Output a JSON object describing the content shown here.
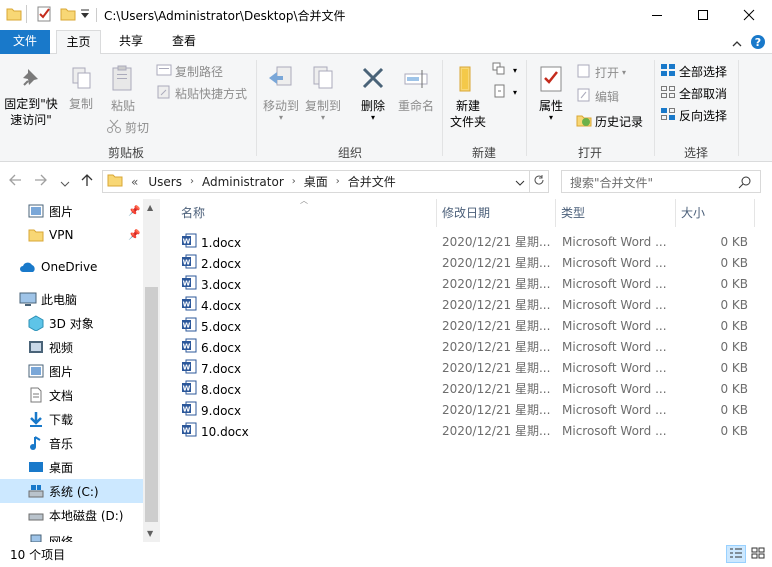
{
  "window": {
    "path": "C:\\Users\\Administrator\\Desktop\\合并文件"
  },
  "tabs": {
    "file": "文件",
    "home": "主页",
    "share": "共享",
    "view": "查看"
  },
  "ribbon": {
    "clipboard": {
      "pin_line1": "固定到\"快",
      "pin_line2": "速访问\"",
      "copy": "复制",
      "paste": "粘贴",
      "copy_path": "复制路径",
      "paste_shortcut": "粘贴快捷方式",
      "cut": "剪切",
      "label": "剪贴板"
    },
    "organize": {
      "move_to": "移动到",
      "copy_to": "复制到",
      "delete": "删除",
      "rename": "重命名",
      "label": "组织"
    },
    "new": {
      "new_folder_line1": "新建",
      "new_folder_line2": "文件夹",
      "label": "新建"
    },
    "open": {
      "properties": "属性",
      "open": "打开",
      "edit": "编辑",
      "history": "历史记录",
      "label": "打开"
    },
    "select": {
      "select_all": "全部选择",
      "select_none": "全部取消",
      "invert": "反向选择",
      "label": "选择"
    }
  },
  "address": {
    "overflow": "«",
    "segments": [
      "Users",
      "Administrator",
      "桌面",
      "合并文件"
    ],
    "search_placeholder": "搜索\"合并文件\""
  },
  "nav": [
    {
      "label": "图片",
      "icon": "pictures-icon",
      "pinned": true
    },
    {
      "label": "VPN",
      "icon": "folder-icon",
      "pinned": true
    },
    {
      "label": "OneDrive",
      "icon": "onedrive-icon",
      "pinned": false
    },
    {
      "label": "此电脑",
      "icon": "this-pc-icon",
      "pinned": false
    },
    {
      "label": "3D 对象",
      "icon": "3d-objects-icon",
      "pinned": false
    },
    {
      "label": "视频",
      "icon": "videos-icon",
      "pinned": false
    },
    {
      "label": "图片",
      "icon": "pictures-icon",
      "pinned": false
    },
    {
      "label": "文档",
      "icon": "documents-icon",
      "pinned": false
    },
    {
      "label": "下载",
      "icon": "downloads-icon",
      "pinned": false
    },
    {
      "label": "音乐",
      "icon": "music-icon",
      "pinned": false
    },
    {
      "label": "桌面",
      "icon": "desktop-icon",
      "pinned": false
    },
    {
      "label": "系统 (C:)",
      "icon": "system-drive-icon",
      "pinned": false,
      "selected": true
    },
    {
      "label": "本地磁盘 (D:)",
      "icon": "local-disk-icon",
      "pinned": false
    },
    {
      "label": "网络",
      "icon": "network-icon",
      "pinned": false
    }
  ],
  "columns": {
    "name": "名称",
    "date": "修改日期",
    "type": "类型",
    "size": "大小"
  },
  "files": [
    {
      "name": "1.docx",
      "date": "2020/12/21 星期...",
      "type": "Microsoft Word ...",
      "size": "0 KB"
    },
    {
      "name": "2.docx",
      "date": "2020/12/21 星期...",
      "type": "Microsoft Word ...",
      "size": "0 KB"
    },
    {
      "name": "3.docx",
      "date": "2020/12/21 星期...",
      "type": "Microsoft Word ...",
      "size": "0 KB"
    },
    {
      "name": "4.docx",
      "date": "2020/12/21 星期...",
      "type": "Microsoft Word ...",
      "size": "0 KB"
    },
    {
      "name": "5.docx",
      "date": "2020/12/21 星期...",
      "type": "Microsoft Word ...",
      "size": "0 KB"
    },
    {
      "name": "6.docx",
      "date": "2020/12/21 星期...",
      "type": "Microsoft Word ...",
      "size": "0 KB"
    },
    {
      "name": "7.docx",
      "date": "2020/12/21 星期...",
      "type": "Microsoft Word ...",
      "size": "0 KB"
    },
    {
      "name": "8.docx",
      "date": "2020/12/21 星期...",
      "type": "Microsoft Word ...",
      "size": "0 KB"
    },
    {
      "name": "9.docx",
      "date": "2020/12/21 星期...",
      "type": "Microsoft Word ...",
      "size": "0 KB"
    },
    {
      "name": "10.docx",
      "date": "2020/12/21 星期...",
      "type": "Microsoft Word ...",
      "size": "0 KB"
    }
  ],
  "status": {
    "count": "10 个项目"
  },
  "colors": {
    "accent": "#1979ca",
    "selection": "#cce8ff",
    "word_blue": "#2b579a",
    "folder_yellow": "#f8d775"
  }
}
